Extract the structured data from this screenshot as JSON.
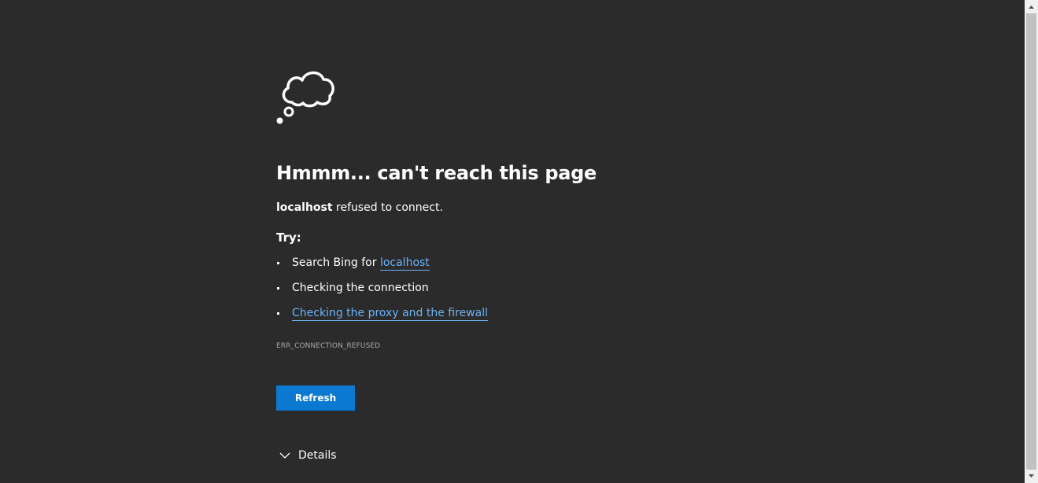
{
  "error": {
    "heading": "Hmmm... can't reach this page",
    "host": "localhost",
    "host_message": " refused to connect.",
    "try_label": "Try:",
    "suggestions": {
      "search_prefix": "Search Bing for ",
      "search_link": "localhost",
      "connection": "Checking the connection",
      "proxy_link": "Checking the proxy and the firewall"
    },
    "code": "ERR_CONNECTION_REFUSED",
    "refresh_label": "Refresh",
    "details_label": "Details"
  },
  "colors": {
    "background": "#2b2b2b",
    "link": "#6db3f6",
    "button": "#0b78d1"
  },
  "icons": {
    "illustration": "cloud-thought-icon",
    "expand": "chevron-down-icon"
  }
}
